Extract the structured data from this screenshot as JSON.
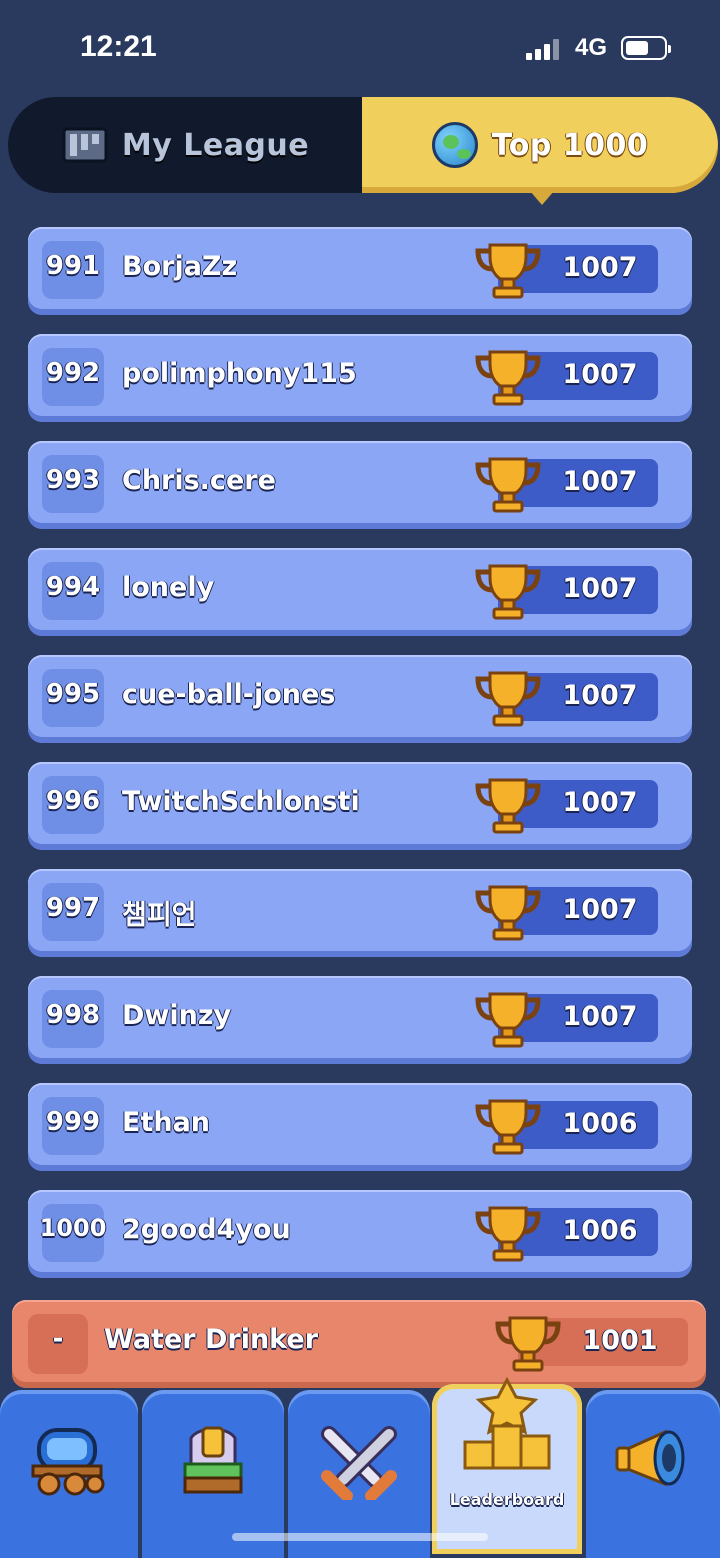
{
  "status_bar": {
    "time": "12:21",
    "network": "4G"
  },
  "tabs": [
    {
      "label": "My League",
      "icon": "league-icon",
      "active": false
    },
    {
      "label": "Top 1000",
      "icon": "globe-icon",
      "active": true
    }
  ],
  "rows": [
    {
      "rank": "991",
      "name": "BorjaZz",
      "score": "1007"
    },
    {
      "rank": "992",
      "name": "polimphony115",
      "score": "1007"
    },
    {
      "rank": "993",
      "name": "Chris.cere",
      "score": "1007"
    },
    {
      "rank": "994",
      "name": "lonely",
      "score": "1007"
    },
    {
      "rank": "995",
      "name": "cue-ball-jones",
      "score": "1007"
    },
    {
      "rank": "996",
      "name": "TwitchSchlonsti",
      "score": "1007"
    },
    {
      "rank": "997",
      "name": "챔피언",
      "score": "1007"
    },
    {
      "rank": "998",
      "name": "Dwinzy",
      "score": "1007"
    },
    {
      "rank": "999",
      "name": "Ethan",
      "score": "1006"
    },
    {
      "rank": "1000",
      "name": "2good4you",
      "score": "1006"
    }
  ],
  "me": {
    "rank": "-",
    "name": "Water Drinker",
    "score": "1001"
  },
  "nav": [
    {
      "icon": "wagon-icon",
      "label": ""
    },
    {
      "icon": "castle-icon",
      "label": ""
    },
    {
      "icon": "crossed-swords-icon",
      "label": ""
    },
    {
      "icon": "podium-star-icon",
      "label": "Leaderboard",
      "active": true
    },
    {
      "icon": "megaphone-icon",
      "label": ""
    }
  ],
  "colors": {
    "accent": "#f1cf5c",
    "row": "#8ba6f4",
    "me_row": "#e7866a",
    "nav": "#3a73e0"
  }
}
